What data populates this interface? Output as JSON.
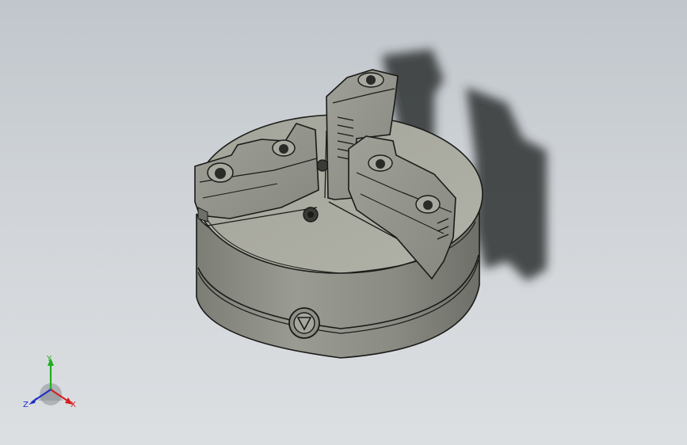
{
  "viewport": {
    "background_top": "#c0c6cc",
    "background_bottom": "#dcdfe2"
  },
  "model": {
    "icons": [
      "three-jaw-chuck-model"
    ],
    "body_color": "#8e8f86",
    "face_color": "#a8a99f",
    "edge_color": "#1a1a18",
    "shadow_color": "#2e3033"
  },
  "triad": {
    "x_label": "X",
    "y_label": "Y",
    "z_label": "Z",
    "x_color": "#d42020",
    "y_color": "#1fae1f",
    "z_color": "#2030c8"
  }
}
